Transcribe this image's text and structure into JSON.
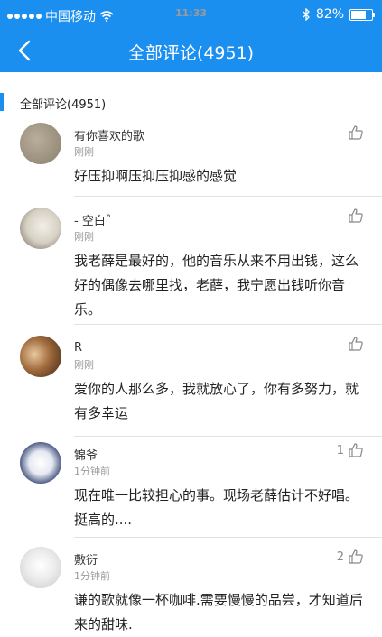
{
  "status_bar": {
    "carrier": "中国移动",
    "time": "11:33",
    "battery": "82%",
    "battery_level": 0.82
  },
  "nav": {
    "title": "全部评论(4951)",
    "back_icon": "chevron-left-icon"
  },
  "section": {
    "title": "全部评论(4951)"
  },
  "comments": [
    {
      "user": "有你喜欢的歌",
      "time": "刚刚",
      "likes": "",
      "text": "好压抑啊压抑压抑感的感觉"
    },
    {
      "user": "- 空白˚",
      "time": "刚刚",
      "likes": "",
      "text": "我老薛是最好的，他的音乐从来不用出钱，这么好的偶像去哪里找，老薛，我宁愿出钱听你音乐。"
    },
    {
      "user": "R",
      "time": "刚刚",
      "likes": "",
      "text": "爱你的人那么多，我就放心了，你有多努力，就有多幸运"
    },
    {
      "user": "锦爷",
      "time": "1分钟前",
      "likes": "1",
      "text": "现在唯一比较担心的事。现场老薛估计不好唱。挺高的...."
    },
    {
      "user": "敷衍",
      "time": "1分钟前",
      "likes": "2",
      "text": "谦的歌就像一杯咖啡.需要慢慢的品尝，才知道后来的甜味."
    }
  ],
  "colors": {
    "brand": "#1b8ff0"
  }
}
